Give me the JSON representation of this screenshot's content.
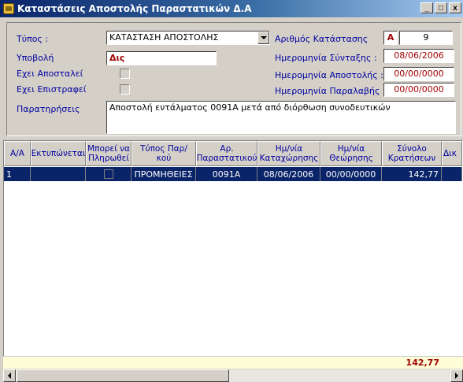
{
  "window": {
    "title": "Καταστάσεις Αποστολής Παραστατικών Δ.Α",
    "min_label": "_",
    "max_label": "□",
    "close_label": "x"
  },
  "form": {
    "type_label": "Τύπος :",
    "type_value": "ΚΑΤΑΣΤΑΣΗ ΑΠΟΣΤΟΛΗΣ",
    "submission_label": "Υποβολή",
    "submission_value": "Δις",
    "sent_label": "Εχει Αποσταλεί",
    "returned_label": "Εχει Επιστραφεί",
    "notes_label": "Παρατηρήσεις",
    "notes_value": "Αποστολή εντάλματος 0091Α μετά από διόρθωση συνοδευτικών",
    "number_label": "Αριθμός Κατάστασης",
    "number_series": "Α",
    "number_value": "9",
    "creation_date_label": "Ημερομηνία Σύνταξης :",
    "creation_date_value": "08/06/2006",
    "send_date_label": "Ημερομηνία Αποστολής :",
    "send_date_value": "00/00/0000",
    "receipt_date_label": "Ημερομηνία Παραλαβής :",
    "receipt_date_value": "00/00/0000"
  },
  "grid": {
    "columns": [
      "Α/Α",
      "Εκτυπώνεται",
      "Μπορεί να Πληρωθεί",
      "Τύπος Παρ/κού",
      "Αρ. Παραστατικού",
      "Ημ/νία Καταχώρησης",
      "Ημ/νία Θεώρησης",
      "Σύνολο Κρατήσεων",
      "Δικ"
    ],
    "rows": [
      {
        "aa": "1",
        "printed": "",
        "type": "ΠΡΟΜΗΘΕΙΕΣ",
        "doc_no": "0091Α",
        "entry_date": "08/06/2006",
        "review_date": "00/00/0000",
        "total": "142,77"
      }
    ],
    "footer_total": "142,77"
  }
}
